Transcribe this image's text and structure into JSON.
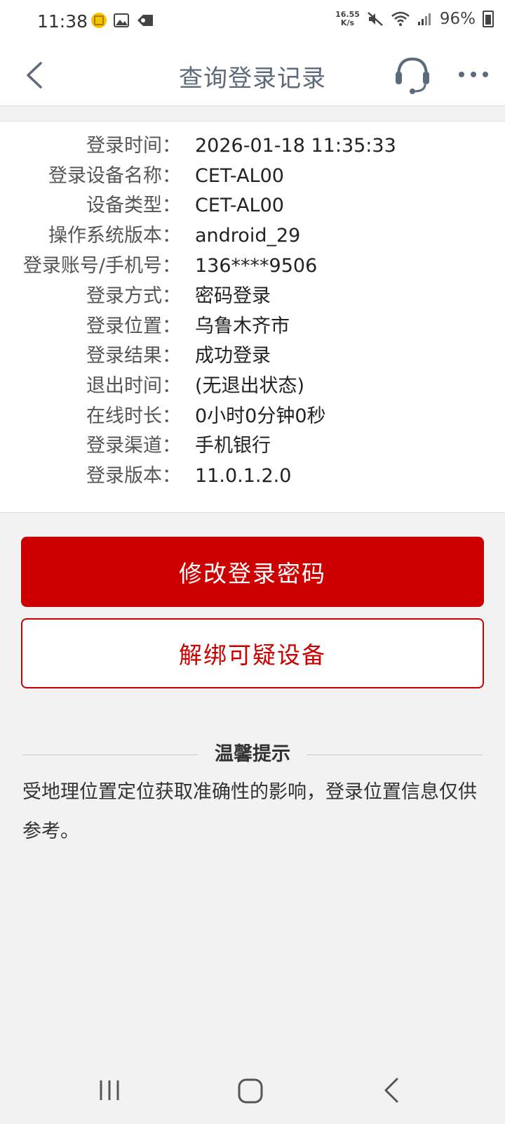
{
  "status_bar": {
    "time": "11:38",
    "net_speed_value": "16.55",
    "net_speed_unit": "K/s",
    "battery": "96%",
    "left_icons": [
      "app-coin-icon",
      "gallery-icon",
      "tag-icon"
    ],
    "right_icons": [
      "mute-icon",
      "wifi-icon",
      "signal-icon",
      "battery-icon"
    ]
  },
  "header": {
    "title": "查询登录记录",
    "back_icon": "chevron-left-icon",
    "service_icon": "headset-icon",
    "more_icon": "more-dots-icon"
  },
  "login_record": [
    {
      "label": "登录时间：",
      "value": "2026-01-18   11:35:33"
    },
    {
      "label": "登录设备名称：",
      "value": "CET-AL00"
    },
    {
      "label": "设备类型：",
      "value": "CET-AL00"
    },
    {
      "label": "操作系统版本：",
      "value": "android_29"
    },
    {
      "label": "登录账号/手机号：",
      "value": "136****9506"
    },
    {
      "label": "登录方式：",
      "value": "密码登录"
    },
    {
      "label": "登录位置：",
      "value": "乌鲁木齐市"
    },
    {
      "label": "登录结果：",
      "value": "成功登录"
    },
    {
      "label": "退出时间：",
      "value": "(无退出状态)"
    },
    {
      "label": "在线时长：",
      "value": "0小时0分钟0秒"
    },
    {
      "label": "登录渠道：",
      "value": "手机银行"
    },
    {
      "label": "登录版本：",
      "value": "11.0.1.2.0"
    }
  ],
  "actions": {
    "change_password": "修改登录密码",
    "unbind_device": "解绑可疑设备"
  },
  "tips": {
    "title": "温馨提示",
    "text": "受地理位置定位获取准确性的影响，登录位置信息仅供参考。"
  },
  "colors": {
    "accent": "#cc0000",
    "title": "#5b6b7a",
    "background": "#f2f2f2"
  }
}
